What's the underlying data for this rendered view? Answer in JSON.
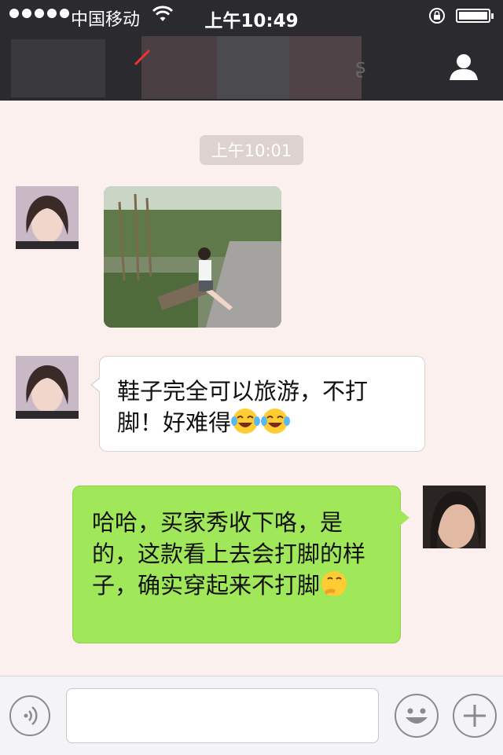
{
  "status_bar": {
    "carrier": "中国移动",
    "time": "上午10:49"
  },
  "chat": {
    "timestamp": "上午10:01",
    "messages": [
      {
        "side": "left",
        "type": "image"
      },
      {
        "side": "left",
        "type": "text",
        "text": "鞋子完全可以旅游，不打脚！好难得"
      },
      {
        "side": "right",
        "type": "text",
        "text": "哈哈，买家秀收下咯，是的，这款看上去会打脚的样子，确实穿起来不打脚"
      }
    ]
  },
  "input_bar": {
    "value": "",
    "icons": [
      "voice-icon",
      "emoji-icon",
      "plus-icon"
    ]
  },
  "colors": {
    "nav_bg": "#2b2b2f",
    "chat_bg": "#fcf0ee",
    "sent_bubble": "#a0e75a",
    "received_bubble": "#ffffff"
  }
}
